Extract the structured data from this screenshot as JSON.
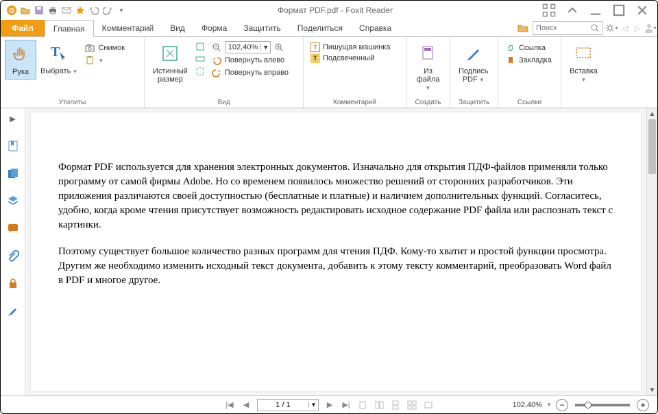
{
  "title": "Формат PDF.pdf - Foxit Reader",
  "tabs": {
    "file": "Файл",
    "home": "Главная",
    "comment": "Комментарий",
    "view": "Вид",
    "form": "Форма",
    "protect": "Защитить",
    "share": "Поделиться",
    "help": "Справка"
  },
  "search": {
    "placeholder": "Поиск"
  },
  "ribbon": {
    "utilities": {
      "label": "Утилиты",
      "hand": "Рука",
      "select": "Выбрать",
      "snapshot": "Снимок"
    },
    "view_group": {
      "label": "Вид",
      "actual": "Истинный\nразмер",
      "zoom_value": "102,40%",
      "rotate_left": "Повернуть влево",
      "rotate_right": "Повернуть вправо"
    },
    "comment_group": {
      "label": "Комментарий",
      "typewriter": "Пишущая машинка",
      "highlight": "Подсвеченный"
    },
    "create_group": {
      "label": "Создать",
      "from_file": "Из\nфайла"
    },
    "protect_group": {
      "label": "Защитить",
      "pdfsign": "Подпись\nPDF"
    },
    "links_group": {
      "label": "Ссылки",
      "link": "Ссылка",
      "bookmark": "Закладка"
    },
    "insert_group": {
      "label": "",
      "insert": "Вставка"
    }
  },
  "document": {
    "para1": "Формат PDF используется для хранения электронных документов. Изначально для открытия ПДФ-файлов применяли только программу от самой фирмы Adobe. Но со временем появилось множество решений от сторонних разработчиков. Эти приложения различаются своей доступностью (бесплатные и платные) и наличием дополнительных функций. Согласитесь, удобно, когда кроме чтения присутствует возможность редактировать исходное содержание PDF файла или распознать текст с картинки.",
    "para2": "Поэтому существует большое количество разных программ для чтения ПДФ. Кому-то хватит и простой функции просмотра. Другим же необходимо изменить исходный текст документа, добавить к этому тексту комментарий, преобразовать Word файл в PDF и многое другое."
  },
  "status": {
    "page": "1 / 1",
    "zoom": "102,40%"
  }
}
